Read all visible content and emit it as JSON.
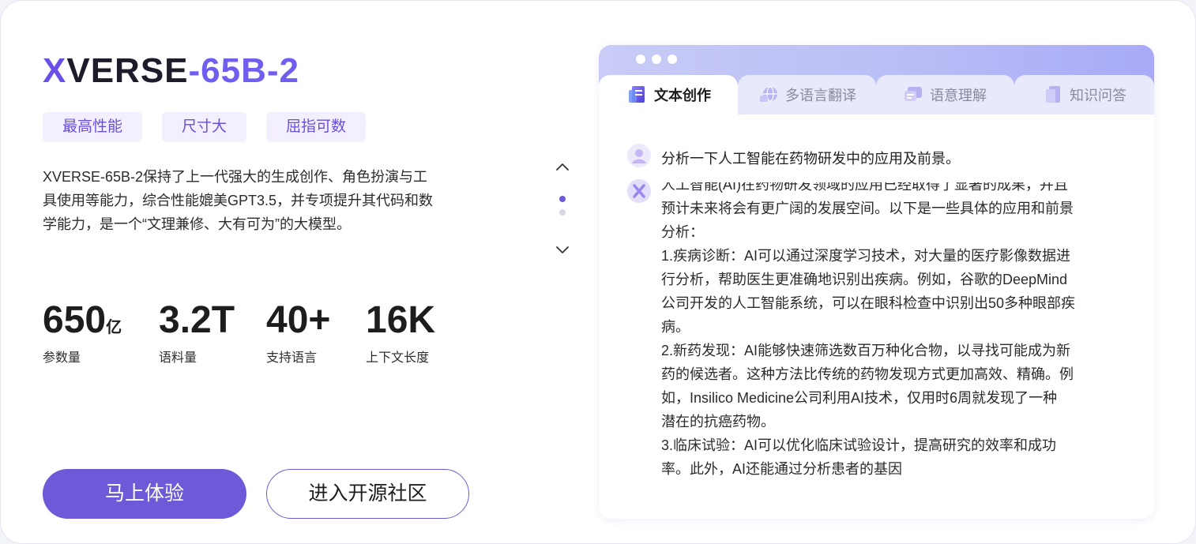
{
  "model": {
    "title_x": "X",
    "title_base": "VERSE",
    "title_suffix": "-65B-2"
  },
  "tags": [
    "最高性能",
    "尺寸大",
    "屈指可数"
  ],
  "description": "XVERSE-65B-2保持了上一代强大的生成创作、角色扮演与工具使用等能力，综合性能媲美GPT3.5，并专项提升其代码和数学能力，是一个“文理兼修、大有可为”的大模型。",
  "stats": [
    {
      "value": "650",
      "unit": "亿",
      "label": "参数量"
    },
    {
      "value": "3.2T",
      "unit": "",
      "label": "语料量"
    },
    {
      "value": "40+",
      "unit": "",
      "label": "支持语言"
    },
    {
      "value": "16K",
      "unit": "",
      "label": "上下文长度"
    }
  ],
  "buttons": {
    "primary": "马上体验",
    "secondary": "进入开源社区"
  },
  "pager": {
    "up_icon": "chevron-up-icon",
    "down_icon": "chevron-down-icon",
    "pages": 2,
    "active_page": 1
  },
  "tabs": [
    {
      "label": "文本创作",
      "icon": "document-icon",
      "active": true
    },
    {
      "label": "多语言翻译",
      "icon": "globe-icon",
      "active": false
    },
    {
      "label": "语意理解",
      "icon": "message-icon",
      "active": false
    },
    {
      "label": "知识问答",
      "icon": "book-icon",
      "active": false
    }
  ],
  "chat": {
    "question": "分析一下人工智能在药物研发中的应用及前景。",
    "answer_lines": [
      "人工智能(AI)在药物研发领域的应用已经取得了显著的成果，并且",
      "预计未来将会有更广阔的发展空间。以下是一些具体的应用和前景",
      "分析：",
      "1.疾病诊断：AI可以通过深度学习技术，对大量的医疗影像数据进",
      "行分析，帮助医生更准确地识别出疾病。例如，谷歌的DeepMind",
      "公司开发的人工智能系统，可以在眼科检查中识别出50多种眼部疾",
      "病。",
      "2.新药发现：AI能够快速筛选数百万种化合物，以寻找可能成为新",
      "药的候选者。这种方法比传统的药物发现方式更加高效、精确。例",
      "如，Insilico Medicine公司利用AI技术，仅用时6周就发现了一种",
      "潜在的抗癌药物。",
      "3.临床试验：AI可以优化临床试验设计，提高研究的效率和成功",
      "率。此外，AI还能通过分析患者的基因"
    ]
  },
  "colors": {
    "brand": "#6d5ad9",
    "tag_bg": "#f3efff",
    "header_gradient_start": "#c9ccf6",
    "header_gradient_end": "#a8aaf8"
  }
}
